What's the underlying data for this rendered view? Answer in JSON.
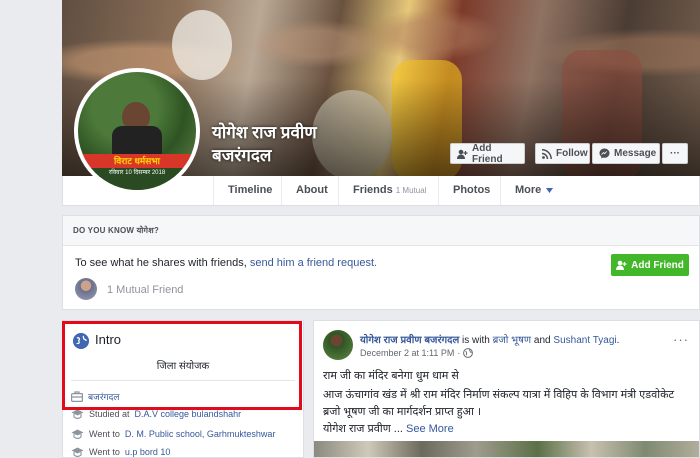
{
  "profile": {
    "name_line1": "योगेश राज प्रवीण",
    "name_line2": "बजरंगदल",
    "avatar_banner": "विराट धर्मसभा",
    "avatar_banner_sub": "रविवार 10 दिसम्बर 2018"
  },
  "cover_buttons": {
    "add_friend": "Add Friend",
    "follow": "Follow",
    "message": "Message",
    "more": "···"
  },
  "nav": {
    "tabs": [
      {
        "label": "Timeline"
      },
      {
        "label": "About"
      },
      {
        "label": "Friends",
        "sub": "1 Mutual"
      },
      {
        "label": "Photos"
      },
      {
        "label": "More"
      }
    ]
  },
  "know": {
    "heading": "DO YOU KNOW योगेश?",
    "text_prefix": "To see what he shares with friends, ",
    "text_link": "send him a friend request.",
    "add_friend": "Add Friend",
    "mutual": "1 Mutual Friend"
  },
  "intro": {
    "title": "Intro",
    "bio": "जिला संयोजक",
    "work": "बजरंगदल",
    "studied_prefix": "Studied at ",
    "studied_place": "D.A.V college bulandshahr",
    "went1_prefix": "Went to ",
    "went1_place": "D. M. Public school, Garhmukteshwar",
    "went2_prefix": "Went to ",
    "went2_place": "u.p bord 10"
  },
  "post": {
    "author": "योगेश राज प्रवीण बजरंगदल",
    "with_text": " is with ",
    "tag1": "ब्रजो भूषण",
    "and_text": " and ",
    "tag2": "Sushant Tyagi",
    "period": ".",
    "date": "December 2 at 1:11 PM",
    "dot": "·",
    "more": "···",
    "line1": "राम जी का मंदिर बनेगा धुम धाम से",
    "line2": "आज ऊंचागांव खंड में श्री राम मंदिर निर्माण संकल्प यात्रा में विहिप के विभाग मंत्री एडवोकेट",
    "line3": "ब्रजो भूषण जी का मार्गदर्शन प्राप्त हुआ ।",
    "line4": "योगेश राज प्रवीण ...",
    "see_more": "See More"
  },
  "colors": {
    "fb_blue": "#4267b2",
    "link": "#365899",
    "green": "#42b72a",
    "highlight_red": "#e10b1c"
  }
}
